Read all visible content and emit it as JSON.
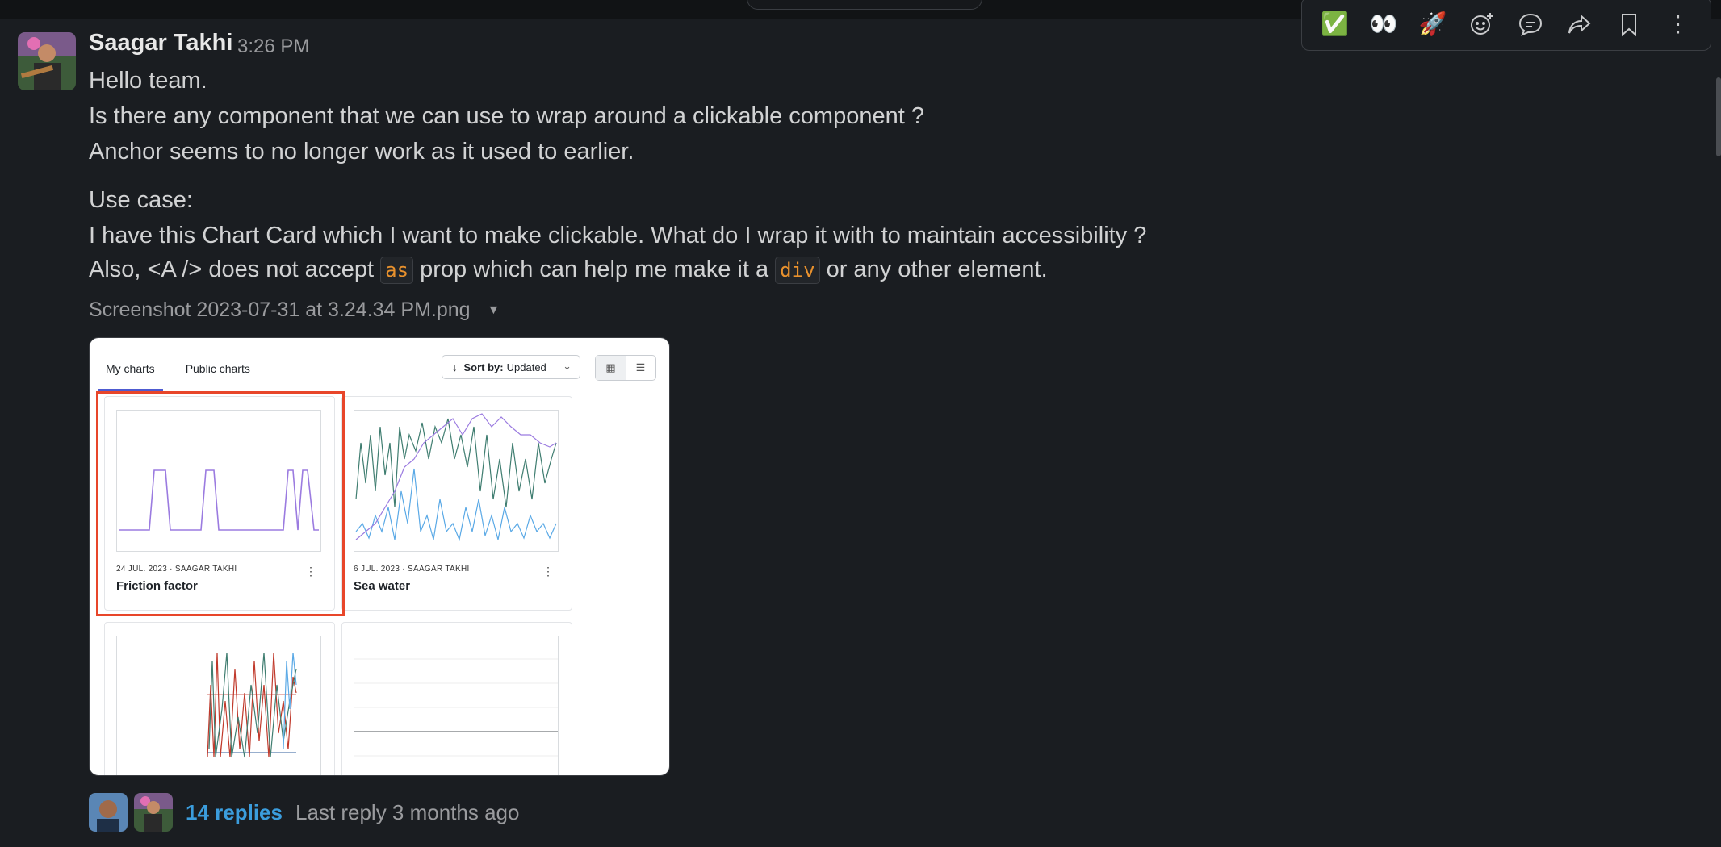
{
  "message": {
    "sender": "Saagar Takhi",
    "time": "3:26 PM",
    "line1": "Hello team.",
    "line2": "Is there any component that we can use to wrap around a clickable component ?",
    "line3": "Anchor seems to no longer work as it used to earlier.",
    "line4": "Use case:",
    "line5": "I have this Chart Card which I want to make clickable. What do I wrap it with to maintain accessibility ?",
    "line6_a": "Also, <A /> does not accept",
    "code1": "as",
    "line6_b": "prop which can help me make it a",
    "code2": "div",
    "line6_c": "or any other element.",
    "attachment_name": "Screenshot 2023-07-31 at 3.24.34 PM.png"
  },
  "screenshot": {
    "tabs": [
      "My charts",
      "Public charts"
    ],
    "sort_label": "Sort by:",
    "sort_value": "Updated",
    "cards": [
      {
        "meta": "24 JUL. 2023 · SAAGAR TAKHI",
        "title": "Friction factor"
      },
      {
        "meta": "6 JUL. 2023 · SAAGAR TAKHI",
        "title": "Sea water"
      }
    ],
    "line_colors": {
      "purple": "#9b7be0",
      "teal": "#3f7d70",
      "blue": "#5aa9e6",
      "red": "#c0392b",
      "gray": "#8a8d91"
    }
  },
  "thread": {
    "reply_count": "14 replies",
    "last_reply": "Last reply 3 months ago"
  },
  "actions": [
    {
      "name": "check-reaction-icon",
      "glyph": "✅"
    },
    {
      "name": "eyes-reaction-icon",
      "glyph": "👀"
    },
    {
      "name": "rocket-reaction-icon",
      "glyph": "🚀"
    },
    {
      "name": "add-reaction-icon",
      "glyph": "☺"
    },
    {
      "name": "reply-in-thread-icon",
      "glyph": "💬"
    },
    {
      "name": "forward-icon",
      "glyph": "↪"
    },
    {
      "name": "bookmark-icon",
      "glyph": "🔖"
    },
    {
      "name": "more-actions-icon",
      "glyph": "⋮"
    }
  ],
  "colors": {
    "accent_link": "#3b9ddd",
    "code_text": "#e8912d",
    "highlight_box": "#e8462a"
  }
}
